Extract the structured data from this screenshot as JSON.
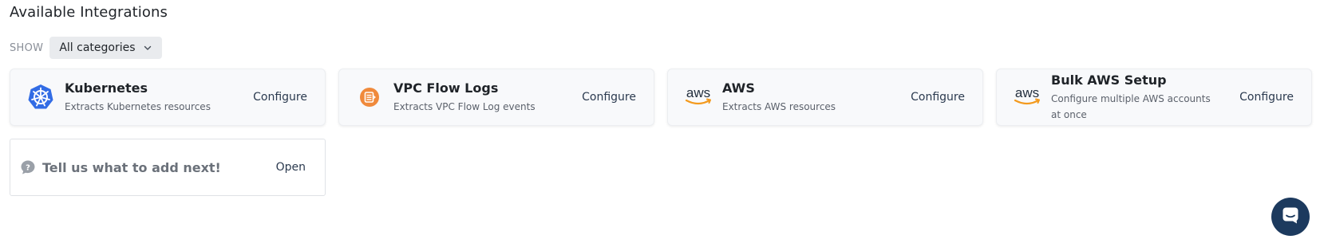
{
  "header": {
    "title": "Available Integrations"
  },
  "filter": {
    "label": "SHOW",
    "selected": "All categories"
  },
  "integrations": [
    {
      "icon": "kubernetes-icon",
      "title": "Kubernetes",
      "description": "Extracts Kubernetes resources",
      "action": "Configure"
    },
    {
      "icon": "vpc-flow-logs-icon",
      "title": "VPC Flow Logs",
      "description": "Extracts VPC Flow Log events",
      "action": "Configure"
    },
    {
      "icon": "aws-icon",
      "title": "AWS",
      "description": "Extracts AWS resources",
      "action": "Configure"
    },
    {
      "icon": "aws-icon",
      "title": "Bulk AWS Setup",
      "description": "Configure multiple AWS accounts at once",
      "action": "Configure"
    }
  ],
  "suggestion": {
    "icon": "question-chat-icon",
    "text": "Tell us what to add next!",
    "action": "Open"
  },
  "chat": {
    "icon": "chat-icon"
  },
  "colors": {
    "kubernetes": "#326ce5",
    "vpc": "#f08a3c",
    "aws_smile": "#f39a1e",
    "chat_launcher": "#1c3a5e"
  }
}
